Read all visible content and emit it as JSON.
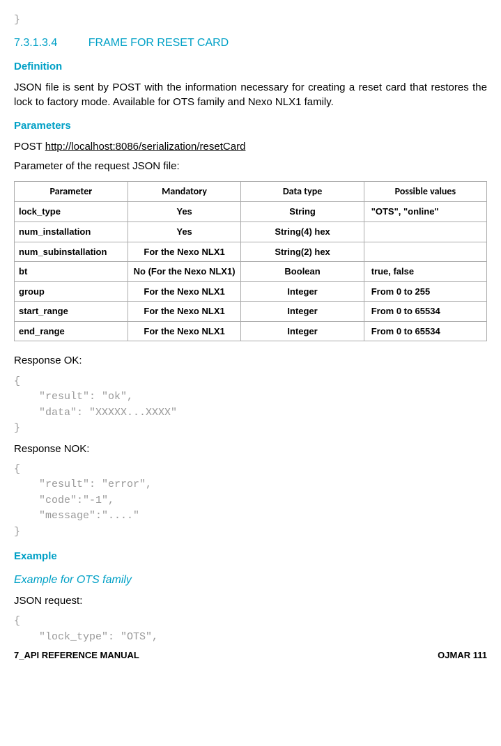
{
  "pre_brace": "}",
  "section": {
    "num": "7.3.1.3.4",
    "title": "FRAME FOR RESET CARD"
  },
  "definition_h": "Definition",
  "definition_p": "JSON file is sent by POST with the information necessary for creating a reset card that restores the lock to factory mode. Available for OTS family and Nexo NLX1 family.",
  "parameters_h": "Parameters",
  "post_label": "POST ",
  "post_url": "http://localhost:8086/serialization/resetCard",
  "param_intro": "Parameter of the request JSON file:",
  "th": {
    "c0": "Parameter",
    "c1": "Mandatory",
    "c2": "Data type",
    "c3": "Possible values"
  },
  "rows": [
    {
      "p": "lock_type",
      "m": "Yes",
      "d": "String",
      "v": "\"OTS\", \"online\""
    },
    {
      "p": "num_installation",
      "m": "Yes",
      "d": "String(4) hex",
      "v": ""
    },
    {
      "p": "num_subinstallation",
      "m": "For the Nexo NLX1",
      "d": "String(2) hex",
      "v": ""
    },
    {
      "p": "bt",
      "m": "No (For the Nexo NLX1)",
      "d": "Boolean",
      "v": "true, false"
    },
    {
      "p": "group",
      "m": "For the Nexo NLX1",
      "d": "Integer",
      "v": "From 0 to 255"
    },
    {
      "p": "start_range",
      "m": "For the Nexo NLX1",
      "d": "Integer",
      "v": "From 0 to 65534"
    },
    {
      "p": "end_range",
      "m": "For the Nexo NLX1",
      "d": "Integer",
      "v": "From 0 to 65534"
    }
  ],
  "resp_ok_label": "Response OK:",
  "resp_ok_code": "{\n    \"result\": \"ok\",\n    \"data\": \"XXXXX...XXXX\"\n}",
  "resp_nok_label": "Response NOK:",
  "resp_nok_code": "{\n    \"result\": \"error\",\n    \"code\":\"-1\",\n    \"message\":\"....\"\n}",
  "example_h": "Example",
  "example_sub": "Example for OTS family",
  "json_req_label": "JSON request:",
  "json_req_code": "{\n    \"lock_type\": \"OTS\",",
  "footer_left": "7_API REFERENCE MANUAL",
  "footer_right": "OJMAR 111"
}
